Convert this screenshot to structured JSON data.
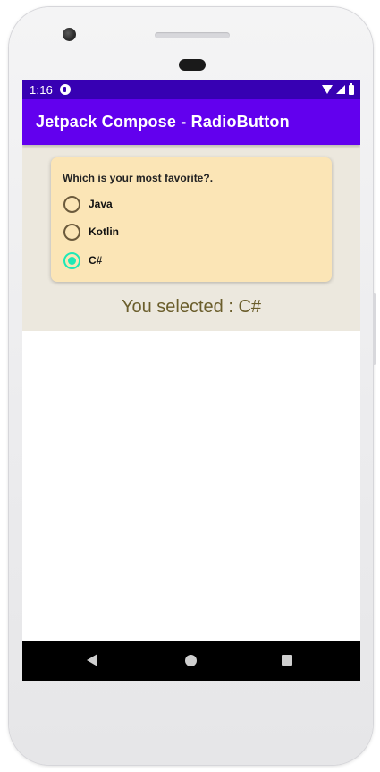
{
  "status_bar": {
    "time": "1:16",
    "icons": [
      "app-notification-icon",
      "wifi-icon",
      "signal-icon",
      "battery-icon"
    ]
  },
  "app_bar": {
    "title": "Jetpack Compose - RadioButton"
  },
  "card": {
    "question": "Which is your most favorite?.",
    "options": [
      {
        "label": "Java",
        "selected": false
      },
      {
        "label": "Kotlin",
        "selected": false
      },
      {
        "label": "C#",
        "selected": true
      }
    ]
  },
  "result": {
    "text": "You selected : C#"
  },
  "nav_bar": {
    "icons": [
      "back-icon",
      "home-icon",
      "recents-icon"
    ]
  },
  "colors": {
    "status_bar": "#3700b3",
    "app_bar": "#6200ee",
    "content_background": "#ece8de",
    "card_background": "#fbe5b6",
    "radio_selected": "#1de9b6",
    "radio_unselected": "#6b5a3c",
    "result_text": "#6b5e2c"
  }
}
